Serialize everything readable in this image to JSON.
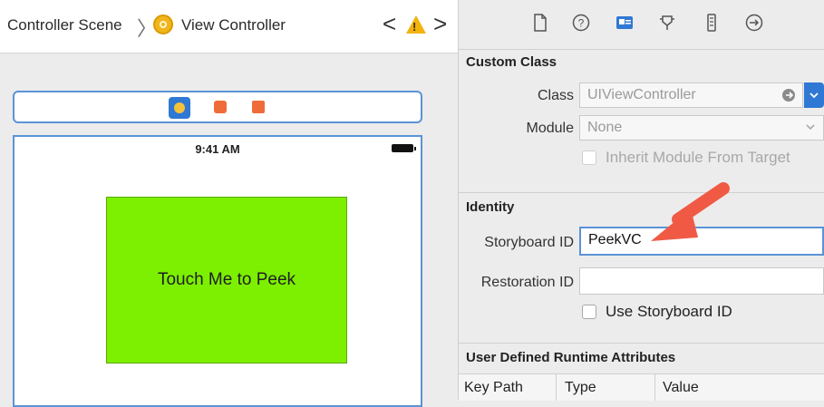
{
  "jumpbar": {
    "crumb1": "Controller Scene",
    "crumb2": "View Controller",
    "sep": "〉",
    "back_arrow": "<",
    "forward_arrow": ">",
    "warning_mark": "!"
  },
  "canvas": {
    "status_time": "9:41 AM",
    "button_label": "Touch Me to Peek",
    "button_color": "#7cf000"
  },
  "inspector": {
    "tab_icons": [
      "file-icon",
      "help-icon",
      "identity-icon",
      "attributes-icon",
      "size-icon",
      "connections-icon"
    ],
    "custom_class": {
      "title": "Custom Class",
      "class_label": "Class",
      "class_value": "UIViewController",
      "module_label": "Module",
      "module_value": "None",
      "inherit_label": "Inherit Module From Target"
    },
    "identity": {
      "title": "Identity",
      "storyboard_label": "Storyboard ID",
      "storyboard_value": "PeekVC",
      "restoration_label": "Restoration ID",
      "restoration_value": "",
      "use_storyboard_label": "Use Storyboard ID"
    },
    "runtime": {
      "title": "User Defined Runtime Attributes",
      "col_key": "Key Path",
      "col_type": "Type",
      "col_value": "Value"
    }
  },
  "accent": "#2f78d3",
  "arrow_color": "#f05a45"
}
